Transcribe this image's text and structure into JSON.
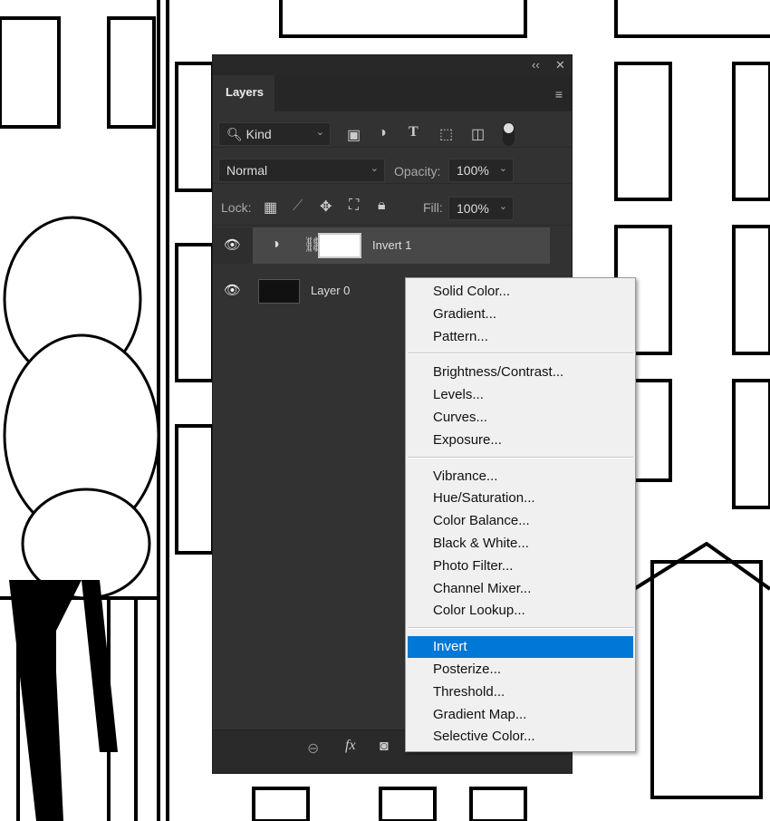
{
  "panel": {
    "collapse": "‹‹",
    "close": "✕",
    "tab": "Layers",
    "panel_menu": "≡",
    "filter": {
      "label": "Kind"
    },
    "blend_mode": "Normal",
    "opacity_label": "Opacity:",
    "opacity": "100%",
    "lock_label": "Lock:",
    "fill_label": "Fill:",
    "fill": "100%",
    "layers": [
      {
        "name": "Invert 1",
        "type": "adjustment",
        "selected": true
      },
      {
        "name": "Layer 0",
        "type": "pixel",
        "selected": false
      }
    ]
  },
  "menu": {
    "groups": [
      [
        "Solid Color...",
        "Gradient...",
        "Pattern..."
      ],
      [
        "Brightness/Contrast...",
        "Levels...",
        "Curves...",
        "Exposure..."
      ],
      [
        "Vibrance...",
        "Hue/Saturation...",
        "Color Balance...",
        "Black & White...",
        "Photo Filter...",
        "Channel Mixer...",
        "Color Lookup..."
      ],
      [
        "Invert",
        "Posterize...",
        "Threshold...",
        "Gradient Map...",
        "Selective Color..."
      ]
    ],
    "highlighted": "Invert",
    "highlight_color": "#0078d7"
  }
}
